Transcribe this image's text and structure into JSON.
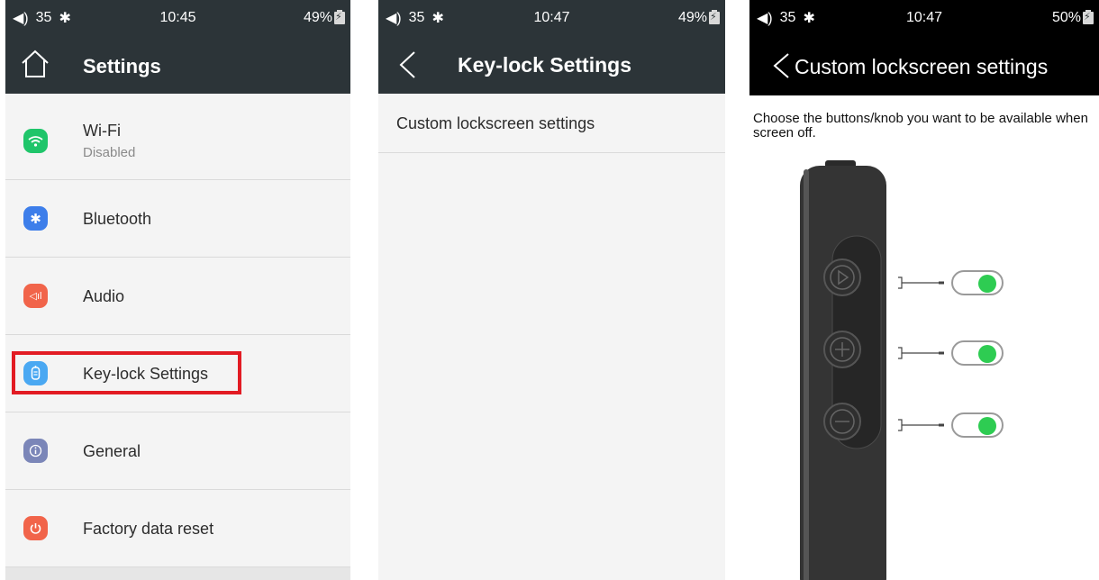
{
  "panel1": {
    "status": {
      "volume": "35",
      "time": "10:45",
      "battery": "49%"
    },
    "header": {
      "title": "Settings",
      "icon": "home-icon"
    },
    "items": [
      {
        "label": "Wi-Fi",
        "sub": "Disabled",
        "icon": "wifi-icon",
        "color": "#1fc56a"
      },
      {
        "label": "Bluetooth",
        "icon": "bluetooth-icon",
        "color": "#3d7eea"
      },
      {
        "label": "Audio",
        "icon": "audio-icon",
        "color": "#f1644a"
      },
      {
        "label": "Key-lock Settings",
        "icon": "keylock-icon",
        "color": "#4aa8f2"
      },
      {
        "label": "General",
        "icon": "info-icon",
        "color": "#7b86b8"
      },
      {
        "label": "Factory data reset",
        "icon": "power-icon",
        "color": "#f1644a"
      }
    ]
  },
  "panel2": {
    "status": {
      "volume": "35",
      "time": "10:47",
      "battery": "49%"
    },
    "header": {
      "title": "Key-lock Settings",
      "icon": "back-icon"
    },
    "items": [
      {
        "label": "Custom lockscreen settings"
      }
    ]
  },
  "panel3": {
    "status": {
      "volume": "35",
      "time": "10:47",
      "battery": "50%"
    },
    "header": {
      "title": "Custom lockscreen settings",
      "icon": "back-icon"
    },
    "description": "Choose the buttons/knob you want to be available when screen off.",
    "buttons": [
      {
        "name": "play",
        "icon": "play-icon",
        "enabled": true
      },
      {
        "name": "volume-up",
        "icon": "plus-icon",
        "enabled": true
      },
      {
        "name": "volume-down",
        "icon": "minus-icon",
        "enabled": true
      }
    ]
  },
  "colors": {
    "header_dark": "#2c3438",
    "highlight": "#e21b23",
    "toggle_on": "#2ecc52"
  }
}
